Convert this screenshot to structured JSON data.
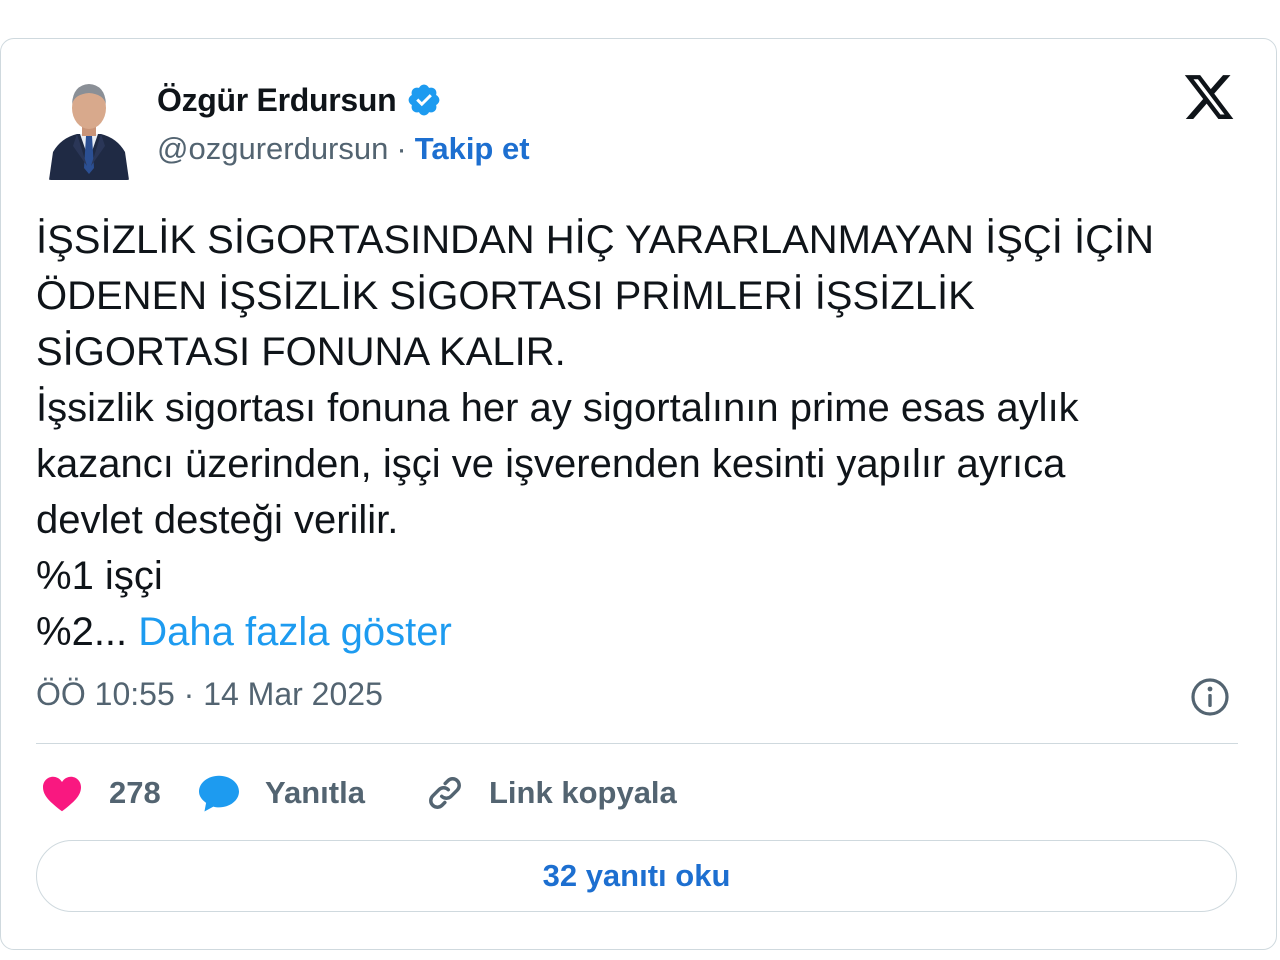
{
  "author": {
    "name": "Özgür Erdursun",
    "handle": "@ozgurerdursun",
    "separator": "·",
    "follow_label": "Takip et",
    "verified_icon": "verified-badge-icon",
    "avatar_icon": "profile-photo"
  },
  "platform_icon": "x-logo-icon",
  "tweet": {
    "text": "İŞSİZLİK SİGORTASINDAN HİÇ YARARLANMAYAN İŞÇİ İÇİN\nÖDENEN İŞSİZLİK SİGORTASI PRİMLERİ İŞSİZLİK\nSİGORTASI FONUNA KALIR.\nİşsizlik sigortası fonuna her ay sigortalının prime esas aylık\nkazancı üzerinden, işçi ve işverenden kesinti yapılır ayrıca\ndevlet desteği verilir.\n%1 işçi\n%2... ",
    "show_more_label": "Daha fazla göster"
  },
  "timestamp": "ÖÖ 10:55 · 14 Mar 2025",
  "info_icon": "info-icon",
  "actions": {
    "like_count": "278",
    "reply_label": "Yanıtla",
    "copy_link_label": "Link kopyala"
  },
  "read_replies_label": "32 yanıtı oku",
  "colors": {
    "like": "#f91880",
    "reply": "#1d9bf0",
    "link": "#1d6fd0",
    "muted": "#536471",
    "text": "#0f1419",
    "border": "#cfd9de"
  }
}
